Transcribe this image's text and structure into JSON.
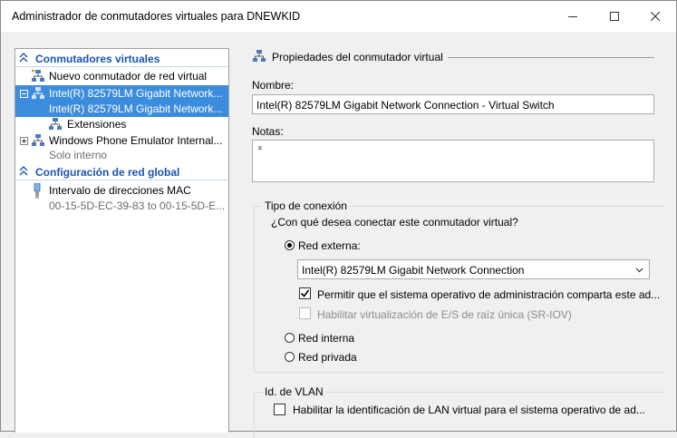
{
  "window": {
    "title": "Administrador de conmutadores virtuales para DNEWKID"
  },
  "tree": {
    "section_virtual": "Conmutadores virtuales",
    "new_switch": "Nuevo conmutador de red virtual",
    "intel_switch": {
      "name": "Intel(R) 82579LM Gigabit Network...",
      "sub": "Intel(R) 82579LM Gigabit Network..."
    },
    "extensions": "Extensiones",
    "wp_emulator": {
      "name": "Windows Phone Emulator Internal...",
      "sub": "Solo interno"
    },
    "section_global": "Configuración de red global",
    "mac_range": {
      "name": "Intervalo de direcciones MAC",
      "sub": "00-15-5D-EC-39-83 to 00-15-5D-E..."
    }
  },
  "props": {
    "header": "Propiedades del conmutador virtual",
    "name_label": "Nombre:",
    "name_value": "Intel(R) 82579LM Gigabit Network Connection - Virtual Switch",
    "notes_label": "Notas:",
    "notes_value": "",
    "conn_group": "Tipo de conexión",
    "conn_question": "¿Con qué desea conectar este conmutador virtual?",
    "external_label": "Red externa:",
    "external_adapter": "Intel(R) 82579LM Gigabit Network Connection",
    "allow_mgmt": "Permitir que el sistema operativo de administración comparta este ad...",
    "sriov": "Habilitar virtualización de E/S de raíz única (SR-IOV)",
    "internal_label": "Red interna",
    "private_label": "Red privada",
    "vlan_group": "Id. de VLAN",
    "vlan_enable": "Habilitar la identificación de LAN virtual para el sistema operativo de ad..."
  },
  "state": {
    "connection_type": "external",
    "allow_mgmt_checked": true,
    "sriov_checked": false,
    "sriov_enabled": false,
    "vlan_checked": false
  },
  "colors": {
    "selection": "#3b8cdd",
    "section_text": "#1a54b3"
  },
  "icons": [
    "minimize-icon",
    "maximize-icon",
    "close-icon",
    "collapse-chevron-icon",
    "network-switch-icon",
    "new-switch-icon",
    "extensions-icon",
    "mac-range-icon",
    "dropdown-arrow-icon",
    "checkmark-icon"
  ]
}
